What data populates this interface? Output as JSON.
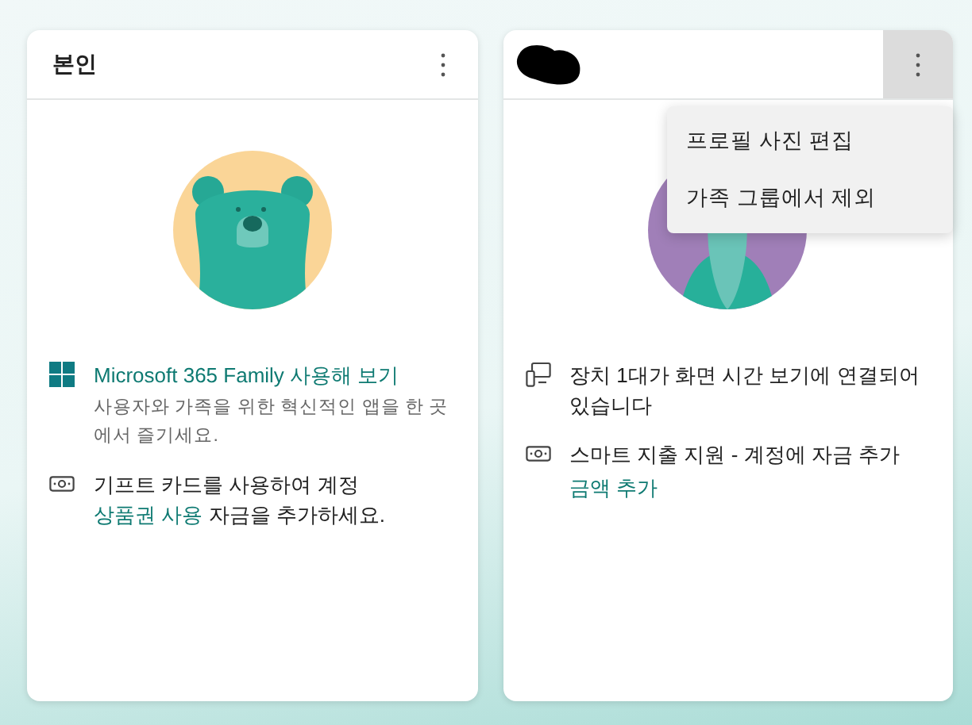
{
  "cards": [
    {
      "header": {
        "kind": "text",
        "text": "본인"
      },
      "menu_open": false,
      "avatar": {
        "kind": "bear"
      },
      "items": [
        {
          "kind": "windows",
          "parts": [
            {
              "text": "Microsoft 365 Family 사용해 보기",
              "link": true
            }
          ],
          "description": "사용자와 가족을 위한 혁신적인 앱을 한 곳에서 즐기세요."
        },
        {
          "kind": "gift-card",
          "parts": [
            {
              "text": "기프트 카드를 사용하여 계정",
              "link": false
            },
            {
              "text": "상품권 사용",
              "link": true
            },
            {
              "text": "자금을 추가하세요.",
              "link": false
            }
          ]
        }
      ]
    },
    {
      "header": {
        "kind": "redacted"
      },
      "menu_open": true,
      "menu": [
        "프로필 사진 편집",
        "가족 그룹에서 제외"
      ],
      "avatar": {
        "kind": "gnome"
      },
      "items": [
        {
          "kind": "devices",
          "parts": [
            {
              "text": "장치 1대가 화면 시간 보기에 연결되어 있습니다",
              "link": false
            }
          ]
        },
        {
          "kind": "money",
          "parts": [
            {
              "text": "스마트 지출 지원 - 계정에 자금 추가",
              "link": false
            }
          ],
          "action": "금액 추가"
        }
      ]
    }
  ]
}
